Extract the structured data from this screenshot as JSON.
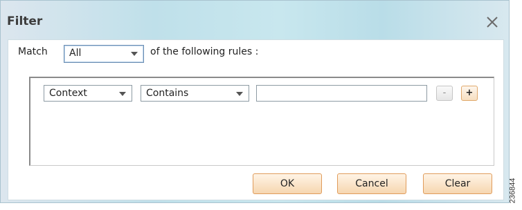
{
  "dialog": {
    "title": "Filter",
    "close_icon": "close-icon"
  },
  "match": {
    "label": "Match",
    "selected": "All",
    "suffix": "of the following rules :"
  },
  "rule": {
    "field_selected": "Context",
    "operator_selected": "Contains",
    "value": "",
    "remove_label": "-",
    "add_label": "+"
  },
  "buttons": {
    "ok": "OK",
    "cancel": "Cancel",
    "clear": "Clear"
  },
  "watermark": "236844",
  "colors": {
    "button_border": "#e09b5a",
    "title_bar_tint": "#bfe0ea"
  }
}
